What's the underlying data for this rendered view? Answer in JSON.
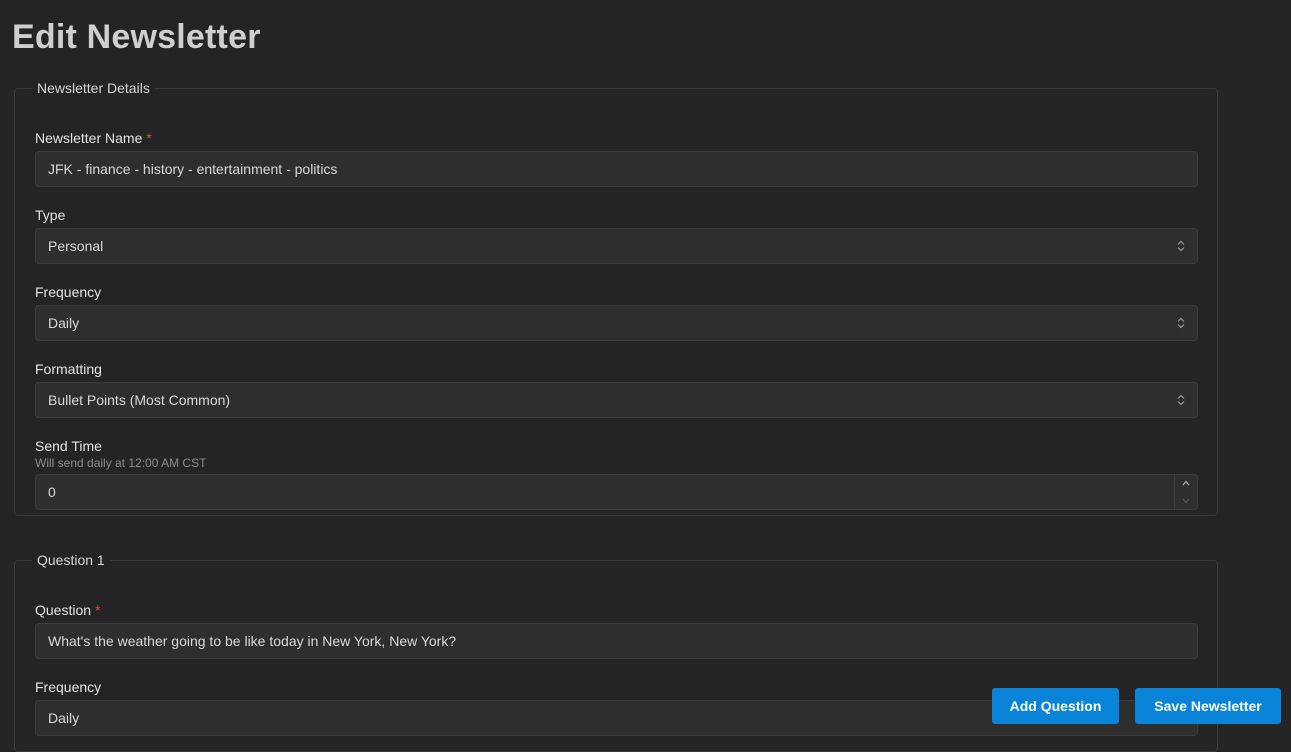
{
  "page": {
    "title": "Edit Newsletter"
  },
  "details": {
    "legend": "Newsletter Details",
    "name": {
      "label": "Newsletter Name",
      "required_mark": "*",
      "value": "JFK - finance - history - entertainment - politics"
    },
    "type": {
      "label": "Type",
      "value": "Personal"
    },
    "frequency": {
      "label": "Frequency",
      "value": "Daily"
    },
    "formatting": {
      "label": "Formatting",
      "value": "Bullet Points (Most Common)"
    },
    "send_time": {
      "label": "Send Time",
      "hint": "Will send daily at 12:00 AM CST",
      "value": "0"
    }
  },
  "question1": {
    "legend": "Question 1",
    "question": {
      "label": "Question",
      "required_mark": "*",
      "value": "What's the weather going to be like today in New York, New York?"
    },
    "frequency": {
      "label": "Frequency",
      "value": "Daily"
    }
  },
  "actions": {
    "add_question": "Add Question",
    "save_newsletter": "Save Newsletter"
  },
  "colors": {
    "background": "#242424",
    "primary_button": "#0a84d8",
    "required": "#e5484d"
  },
  "icons": {
    "select_chevron": "chevron-up-down-icon",
    "stepper_up": "chevron-up-icon",
    "stepper_down": "chevron-down-icon"
  }
}
